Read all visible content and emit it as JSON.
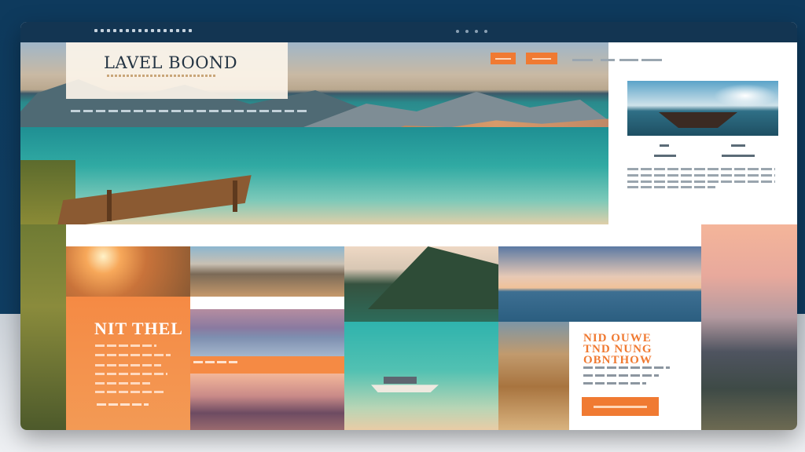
{
  "site": {
    "logo_title": "LAVEL BOOND"
  },
  "promo_left": {
    "title": "NIT THEL"
  },
  "promo_right": {
    "title": "NID OUWE TND NUNG OBNTHOW"
  },
  "colors": {
    "accent": "#f07a32",
    "header": "#133552",
    "background": "#0e3a5d"
  },
  "icons": {
    "window_dots": "dots-icon",
    "carousel_dots": "pagination-dots-icon"
  }
}
